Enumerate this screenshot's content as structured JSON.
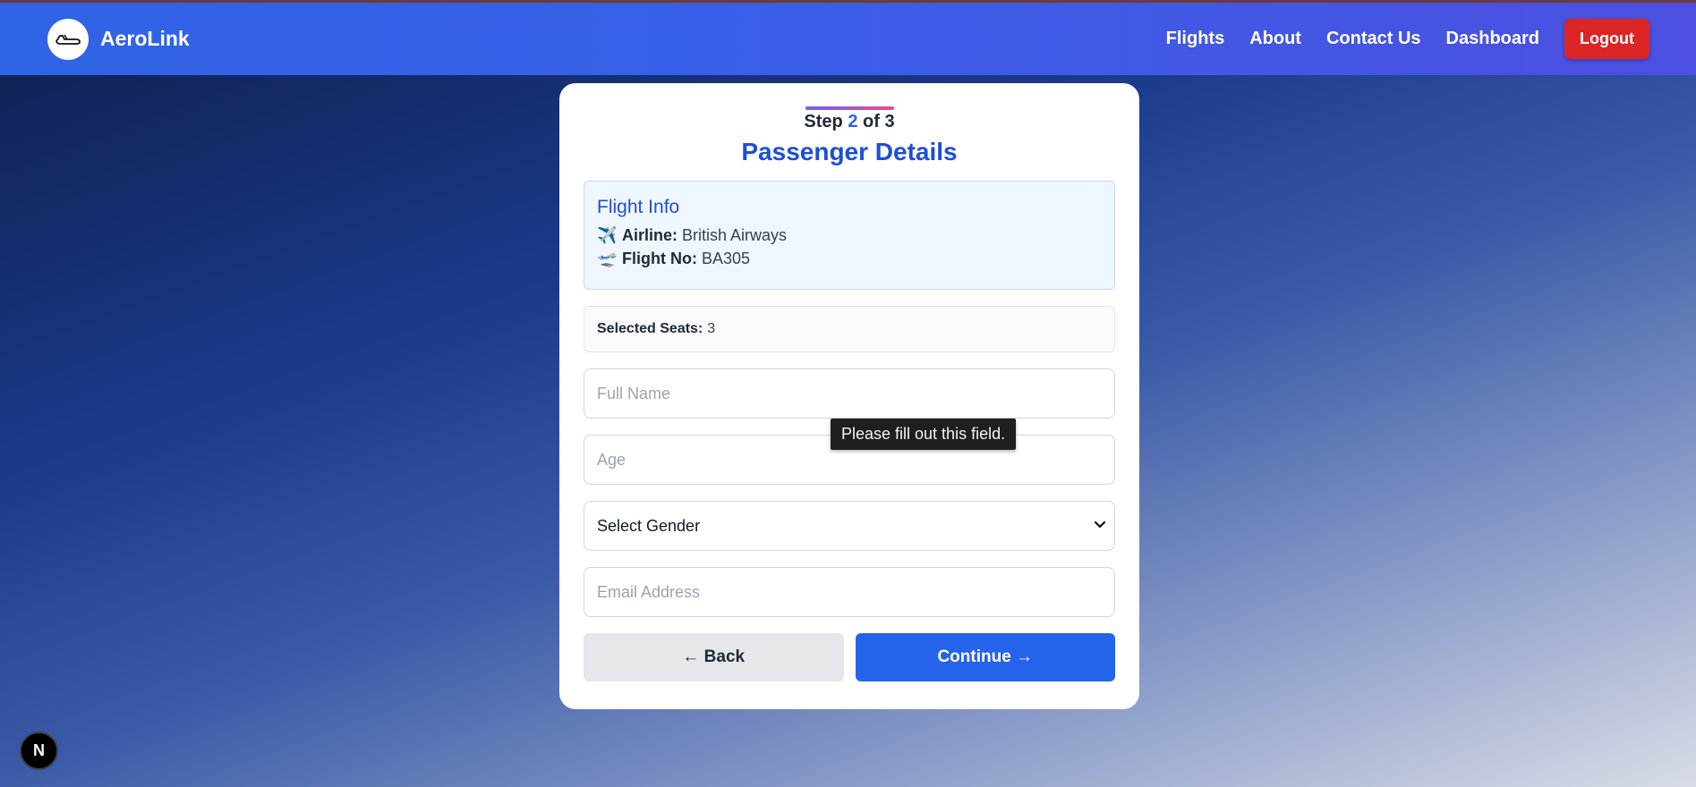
{
  "app": {
    "brand_name": "AeroLink",
    "logo_icon": "airplane-icon"
  },
  "nav": {
    "items": [
      {
        "label": "Flights"
      },
      {
        "label": "About"
      },
      {
        "label": "Contact Us"
      },
      {
        "label": "Dashboard"
      }
    ],
    "logout_label": "Logout"
  },
  "progress": {
    "step_prefix": "Step",
    "current": "2",
    "step_mid": "of",
    "total": "3"
  },
  "page_title": "Passenger Details",
  "flight_info": {
    "title": "Flight Info",
    "airline_icon": "✈️",
    "airline_label": "Airline:",
    "airline_value": "British Airways",
    "flight_icon": "🛫",
    "flight_no_label": "Flight No:",
    "flight_no_value": "BA305"
  },
  "seats": {
    "label": "Selected Seats:",
    "value": "3"
  },
  "form": {
    "full_name_placeholder": "Full Name",
    "age_placeholder": "Age",
    "gender_selected": "Select Gender",
    "email_placeholder": "Email Address"
  },
  "validation": {
    "tooltip": "Please fill out this field."
  },
  "buttons": {
    "back_label": "← Back",
    "continue_label": "Continue →"
  },
  "dev_badge": {
    "letter": "N"
  },
  "colors": {
    "header_start": "#2f64e6",
    "header_end": "#4c4fe0",
    "accent": "#2563eb",
    "title": "#1d4ed8",
    "logout": "#dc2626"
  }
}
